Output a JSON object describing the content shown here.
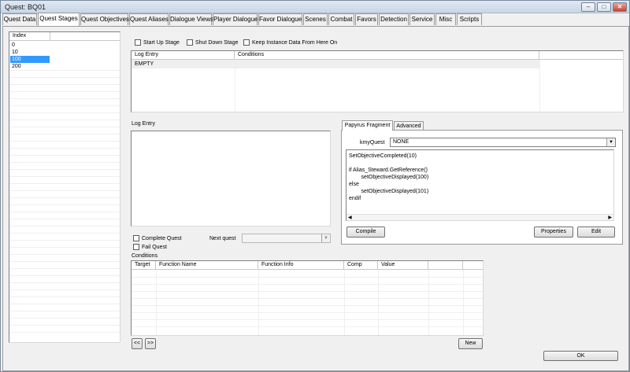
{
  "window": {
    "title": "Quest: BQ01",
    "min_glyph": "–",
    "max_glyph": "□",
    "close_glyph": "✕"
  },
  "tabs": [
    {
      "label": "Quest Data"
    },
    {
      "label": "Quest Stages"
    },
    {
      "label": "Quest Objectives"
    },
    {
      "label": "Quest Aliases"
    },
    {
      "label": "Dialogue Views"
    },
    {
      "label": "Player Dialogue"
    },
    {
      "label": "Favor Dialogue"
    },
    {
      "label": "Scenes"
    },
    {
      "label": "Combat"
    },
    {
      "label": "Favors"
    },
    {
      "label": "Detection"
    },
    {
      "label": "Service"
    },
    {
      "label": "Misc"
    },
    {
      "label": "Scripts"
    }
  ],
  "active_tab": "Quest Stages",
  "index_list": {
    "header": "Index",
    "items": [
      "0",
      "10",
      "100",
      "200"
    ],
    "selected": "100"
  },
  "stage_options": {
    "start_up": "Start Up Stage",
    "shut_down": "Shut Down Stage",
    "keep_instance": "Keep Instance Data From Here On"
  },
  "log_table": {
    "headers": [
      "Log Entry",
      "Conditions"
    ],
    "rows": [
      [
        "EMPTY",
        ""
      ]
    ]
  },
  "log_entry_label": "Log Entry",
  "quest_flags": {
    "complete": "Complete Quest",
    "fail": "Fail Quest"
  },
  "next_quest": {
    "label": "Next quest",
    "value": ""
  },
  "papyrus": {
    "tabs": [
      "Papyrus Fragment",
      "Advanced"
    ],
    "property_label": "kmyQuest",
    "property_value": "NONE",
    "code_lines": [
      "SetObjectiveCompleted(10)",
      "",
      "if Alias_Steward.GetReference()",
      "        setObjectiveDisplayed(100)",
      "else",
      "        setObjectiveDisplayed(101)",
      "endif"
    ],
    "compile_label": "Compile",
    "properties_label": "Properties",
    "edit_label": "Edit"
  },
  "conditions": {
    "label": "Conditions",
    "headers": [
      "Target",
      "Function Name",
      "Function Info",
      "Comp",
      "Value"
    ]
  },
  "nav": {
    "prev_label": "<<",
    "next_label": ">>",
    "new_label": "New"
  },
  "ok_label": "OK",
  "icons": {
    "dropdown": "▼",
    "scroll_left": "◀",
    "scroll_right": "▶"
  }
}
